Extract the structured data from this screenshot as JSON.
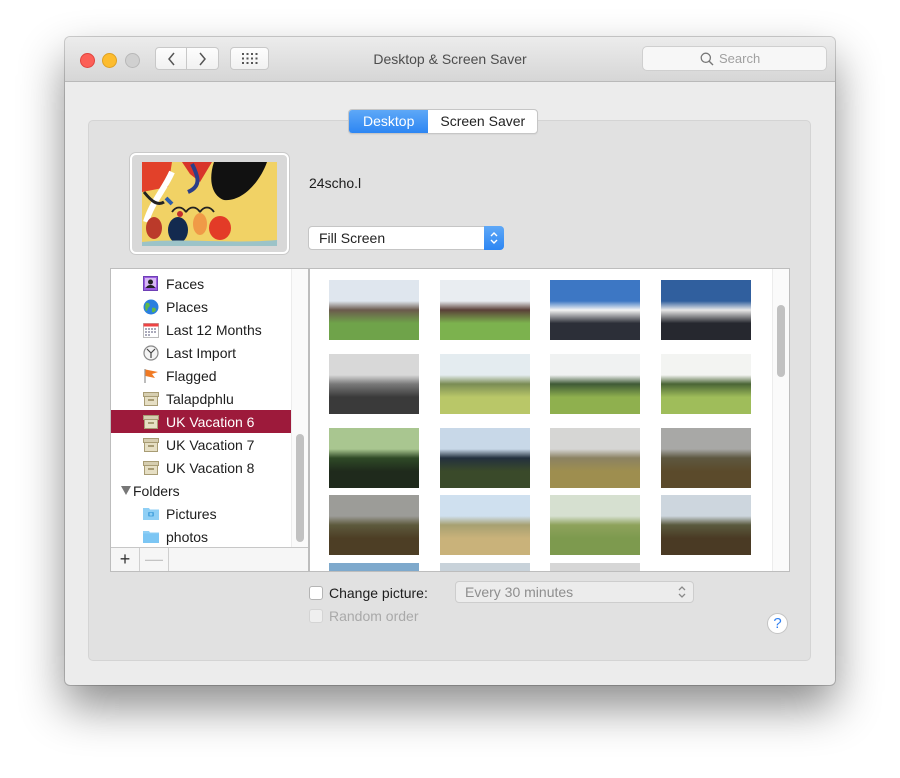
{
  "window": {
    "title": "Desktop & Screen Saver",
    "search_placeholder": "Search"
  },
  "tabs": [
    {
      "label": "Desktop",
      "active": true
    },
    {
      "label": "Screen Saver",
      "active": false
    }
  ],
  "current_picture": {
    "name": "24scho.l",
    "fill_mode": "Fill Screen"
  },
  "sources": [
    {
      "label": "Faces",
      "icon": "faces-icon"
    },
    {
      "label": "Places",
      "icon": "globe-icon"
    },
    {
      "label": "Last 12 Months",
      "icon": "calendar-icon"
    },
    {
      "label": "Last Import",
      "icon": "clock-icon"
    },
    {
      "label": "Flagged",
      "icon": "flag-icon"
    },
    {
      "label": "Talapdphlu",
      "icon": "album-box-icon"
    },
    {
      "label": "UK Vacation 6",
      "icon": "album-box-icon",
      "selected": true
    },
    {
      "label": "UK Vacation 7",
      "icon": "album-box-icon"
    },
    {
      "label": "UK Vacation 8",
      "icon": "album-box-icon"
    },
    {
      "label": "Folders",
      "icon": "disclosure-triangle-icon",
      "group": true
    },
    {
      "label": "Pictures",
      "icon": "pictures-folder-icon"
    },
    {
      "label": "photos",
      "icon": "folder-icon"
    }
  ],
  "source_footer": {
    "add": "+",
    "remove": "—"
  },
  "thumbnails": [
    {
      "subject": "houses-green",
      "colors": [
        "#dfe6ee",
        "#6b5a4d",
        "#6fa34a"
      ]
    },
    {
      "subject": "houses-green",
      "colors": [
        "#e9edf1",
        "#5a4038",
        "#7cb24e"
      ]
    },
    {
      "subject": "white-pub",
      "colors": [
        "#3d77c4",
        "#f4f4f4",
        "#2c2f38"
      ]
    },
    {
      "subject": "white-pub",
      "colors": [
        "#305f9e",
        "#e8e8e8",
        "#26282f"
      ]
    },
    {
      "subject": "church-bw",
      "colors": [
        "#d8d8d8",
        "#7a7a7a",
        "#3a3a3a"
      ]
    },
    {
      "subject": "churchyard",
      "colors": [
        "#e4ecf0",
        "#7a8c54",
        "#b9c768"
      ]
    },
    {
      "subject": "church-path",
      "colors": [
        "#f0f2f2",
        "#3f5a36",
        "#8fb04e"
      ]
    },
    {
      "subject": "church-path",
      "colors": [
        "#f3f4f2",
        "#4a6536",
        "#9fbd5a"
      ]
    },
    {
      "subject": "graves-woods",
      "colors": [
        "#a9c690",
        "#2f4a27",
        "#1f2a1c"
      ]
    },
    {
      "subject": "yew-tree",
      "colors": [
        "#c8d8e8",
        "#23303e",
        "#3a4a2a"
      ]
    },
    {
      "subject": "countryside",
      "colors": [
        "#d6d6d4",
        "#8b8262",
        "#9e8e4f"
      ]
    },
    {
      "subject": "countryside",
      "colors": [
        "#a8a8a6",
        "#5e5840",
        "#5b4a2b"
      ]
    },
    {
      "subject": "countryside",
      "colors": [
        "#9c9c98",
        "#5d5a3d",
        "#4d3e25"
      ]
    },
    {
      "subject": "fields",
      "colors": [
        "#cfe0ef",
        "#a7a071",
        "#c9b27a"
      ]
    },
    {
      "subject": "meadow",
      "colors": [
        "#d6e0d0",
        "#8ea25c",
        "#7d9a4e"
      ]
    },
    {
      "subject": "countryside",
      "colors": [
        "#cdd6de",
        "#5a5a3e",
        "#4a3a24"
      ]
    },
    {
      "subject": "sky",
      "colors": [
        "#7ea9cc",
        "#e8e8e8",
        "#7ea9cc"
      ]
    },
    {
      "subject": "sky",
      "colors": [
        "#c8d2da",
        "#7a9fc0",
        "#c8d2da"
      ]
    },
    {
      "subject": "sky",
      "colors": [
        "#d6d6d6",
        "#6c9cc6",
        "#d6d6d6"
      ]
    },
    {
      "subject": "sky",
      "colors": [
        "#ffffff",
        "#ffffff",
        "#ededed"
      ]
    }
  ],
  "change_picture": {
    "label": "Change picture:",
    "checked": false,
    "interval": "Every 30 minutes"
  },
  "random_order": {
    "label": "Random order",
    "checked": false,
    "enabled": false
  },
  "help": {
    "label": "?"
  },
  "colors": {
    "accent": "#2d86f3",
    "selection": "#9d1a3b",
    "close": "#fc5f57",
    "minimize": "#fdbc2e"
  }
}
